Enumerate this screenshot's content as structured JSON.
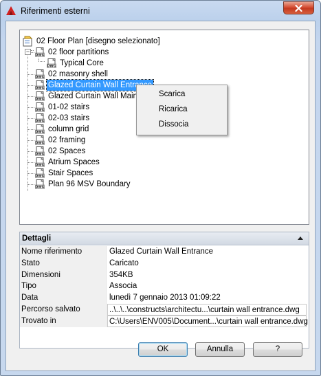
{
  "window": {
    "title": "Riferimenti esterni"
  },
  "tree": {
    "root": "02 Floor Plan [disegno selezionato]",
    "items": [
      {
        "label": "02 floor partitions",
        "level": 1,
        "expanded": true,
        "selected": false
      },
      {
        "label": "Typical Core",
        "level": 2,
        "selected": false
      },
      {
        "label": "02 masonry shell",
        "level": 1,
        "selected": false
      },
      {
        "label": "Glazed Curtain Wall Entrance",
        "level": 1,
        "selected": true
      },
      {
        "label": "Glazed Curtain Wall Main",
        "level": 1,
        "selected": false
      },
      {
        "label": "01-02 stairs",
        "level": 1,
        "selected": false
      },
      {
        "label": "02-03 stairs",
        "level": 1,
        "selected": false
      },
      {
        "label": "column grid",
        "level": 1,
        "selected": false
      },
      {
        "label": "02 framing",
        "level": 1,
        "selected": false
      },
      {
        "label": "02 Spaces",
        "level": 1,
        "selected": false
      },
      {
        "label": "Atrium Spaces",
        "level": 1,
        "selected": false
      },
      {
        "label": "Stair Spaces",
        "level": 1,
        "selected": false
      },
      {
        "label": "Plan 96 MSV Boundary",
        "level": 1,
        "selected": false
      }
    ],
    "icon_text": "DWG"
  },
  "context_menu": {
    "items": [
      "Scarica",
      "Ricarica",
      "Dissocia"
    ]
  },
  "details": {
    "header": "Dettagli",
    "rows": [
      {
        "key": "Nome riferimento",
        "value": "Glazed Curtain Wall Entrance",
        "boxed": false
      },
      {
        "key": "Stato",
        "value": "Caricato",
        "boxed": false
      },
      {
        "key": "Dimensioni",
        "value": "354KB",
        "boxed": false
      },
      {
        "key": "Tipo",
        "value": "Associa",
        "boxed": false
      },
      {
        "key": "Data",
        "value": "lunedì 7 gennaio 2013  01:09:22",
        "boxed": false
      },
      {
        "key": "Percorso salvato",
        "value": "..\\..\\..\\constructs\\architectu...\\curtain wall entrance.dwg",
        "boxed": true
      },
      {
        "key": "Trovato in",
        "value": "C:\\Users\\ENV005\\Document...\\curtain wall entrance.dwg",
        "boxed": true
      }
    ]
  },
  "buttons": {
    "ok": "OK",
    "cancel": "Annulla",
    "help": "?"
  },
  "colors": {
    "selection": "#3399ff",
    "close_button": "#c3381f",
    "app_icon": "#d21f1f"
  }
}
